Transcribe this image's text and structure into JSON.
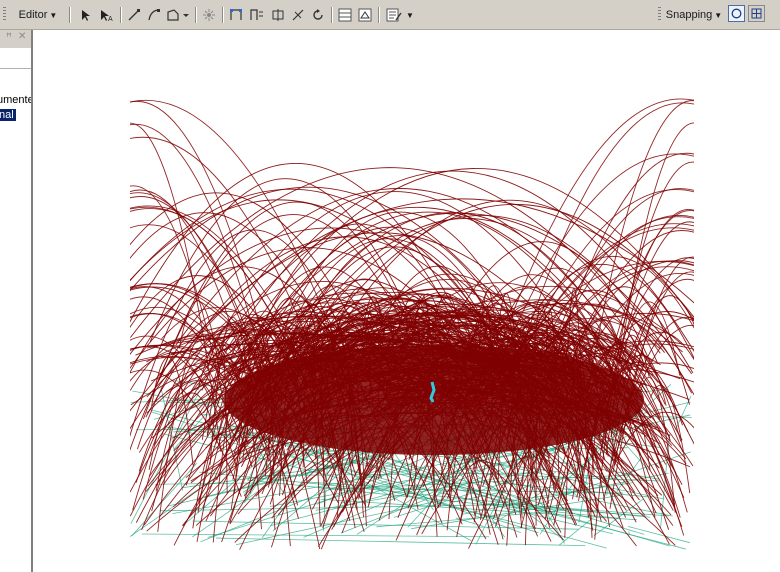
{
  "toolbar": {
    "editor_label": "Editor",
    "tools": [
      "edit-tool-icon",
      "edit-annotation-icon",
      "straight-segment-icon",
      "end-point-arc-icon",
      "trace-icon",
      "point-icon",
      "edit-vertices-icon",
      "reshape-feature-icon",
      "cut-polygons-icon",
      "split-icon",
      "rotate-icon",
      "attributes-icon",
      "sketch-properties-icon",
      "create-features-icon"
    ],
    "snapping_label": "Snapping",
    "snapping_tools": [
      "point-snapping-icon",
      "end-snapping-icon"
    ]
  },
  "toc_panel": {
    "text_line1": "umente",
    "text_line2": "nal"
  },
  "map": {
    "background": "#ffffff",
    "flow_line_color": "#7f0000",
    "secondary_line_color": "#1aa37a",
    "highlight_color": "#2ecbe0"
  }
}
